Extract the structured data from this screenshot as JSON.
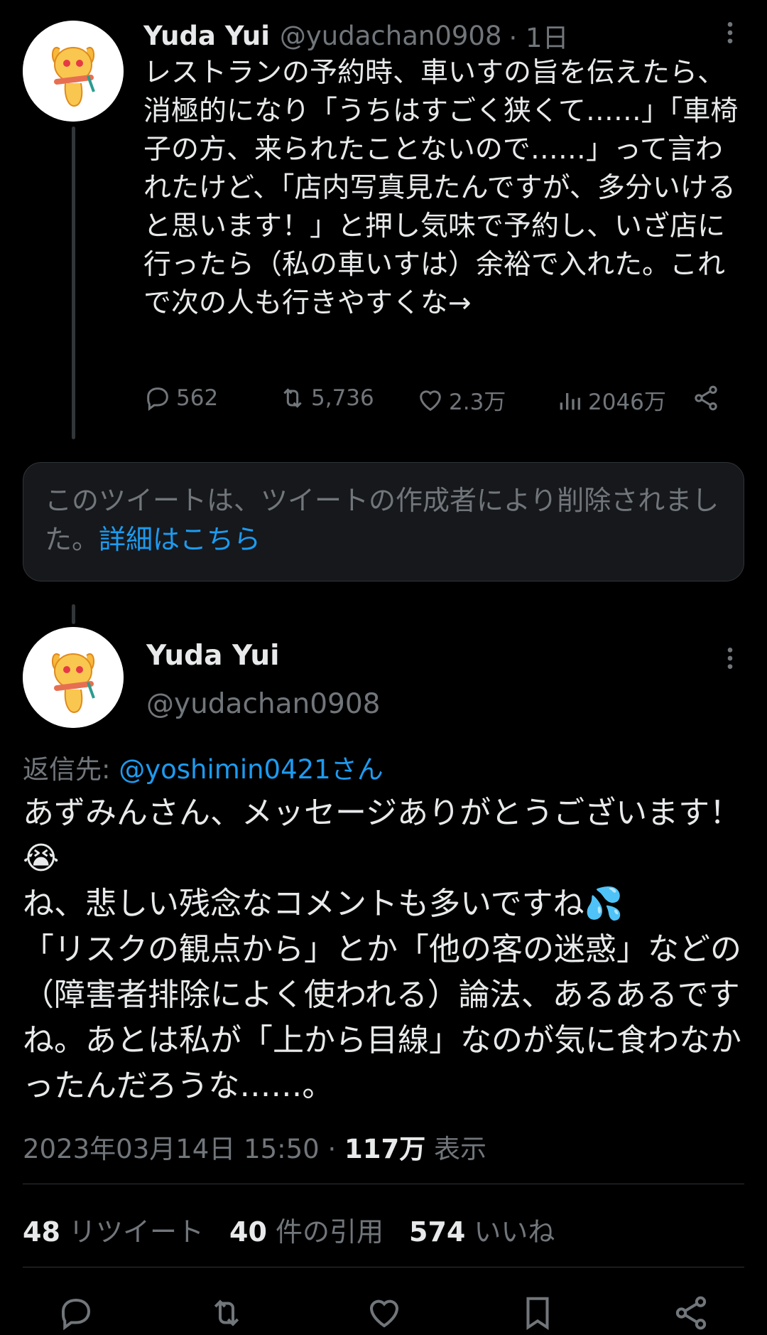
{
  "tweet1": {
    "display_name": "Yuda Yui",
    "handle": "@yudachan0908",
    "time": "· 1日",
    "text": "レストランの予約時、車いすの旨を伝えたら、消極的になり「うちはすごく狭くて……」「車椅子の方、来られたことないので……」って言われたけど、「店内写真見たんですが、多分いけると思います！」と押し気味で予約し、いざ店に行ったら（私の車いすは）余裕で入れた。これで次の人も行きやすくな→",
    "replies": "562",
    "retweets": "5,736",
    "likes": "2.3万",
    "views": "2046万"
  },
  "deleted_notice": {
    "text": "このツイートは、ツイートの作成者により削除されました。",
    "link": "詳細はこちら"
  },
  "tweet2": {
    "display_name": "Yuda Yui",
    "handle": "@yudachan0908",
    "reply_prefix": "返信先:",
    "reply_to": "@yoshimin0421さん",
    "text": "あずみんさん、メッセージありがとうございます！😭\nね、悲しい残念なコメントも多いですね💦\n「リスクの観点から」とか「他の客の迷惑」などの（障害者排除によく使われる）論法、あるあるですね。あとは私が「上から目線」なのが気に食わなかったんだろうな……。",
    "timestamp": "2023年03月14日 15:50 ·",
    "view_count": "117万",
    "view_label": "表示",
    "stats": {
      "retweets_count": "48",
      "retweets_label": "リツイート",
      "quotes_count": "40",
      "quotes_label": "件の引用",
      "likes_count": "574",
      "likes_label": "いいね"
    }
  },
  "icons": [
    "reply-icon",
    "retweet-icon",
    "like-icon",
    "views-icon",
    "share-icon",
    "bookmark-icon",
    "more-icon"
  ],
  "colors": {
    "background": "#000000",
    "text": "#e7e9ea",
    "muted": "#71767b",
    "link": "#1d9bf0",
    "card": "#16181c"
  }
}
